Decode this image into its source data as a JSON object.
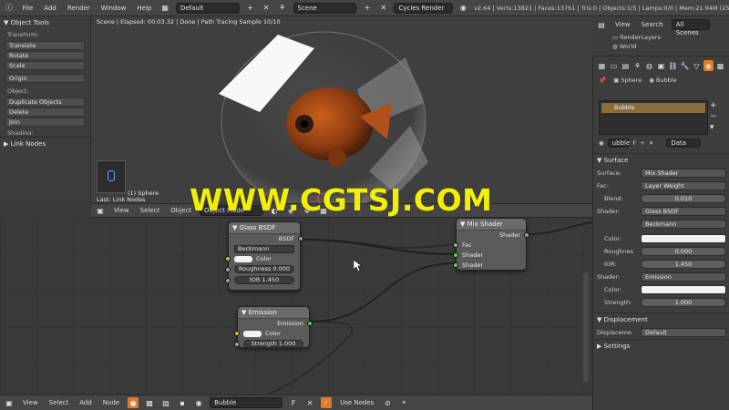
{
  "topbar": {
    "menu": [
      "File",
      "Add",
      "Render",
      "Window",
      "Help"
    ],
    "layout": "Default",
    "scene": "Scene",
    "engine": "Cycles Render",
    "stats": "v2.64 | Verts:13821 | Faces:13761 | Tris:0 | Objects:1/5 | Lamps:0/0 | Mem:21.94M (25.18M) | Sphere"
  },
  "toolshelf": {
    "title": "Object Tools",
    "transform_label": "Transform:",
    "transform_buttons": [
      "Translate",
      "Rotate",
      "Scale"
    ],
    "origin": "Origin",
    "object_label": "Object:",
    "object_buttons": [
      "Duplicate Objects",
      "Delete",
      "Join"
    ],
    "shading_label": "Shading:",
    "link_nodes": "Link Nodes"
  },
  "viewport": {
    "status": "Scene | Elapsed: 00:03.32 | Done | Path Tracing Sample 10/10",
    "object_label": "(1) Sphere",
    "last_op": "Last: Link Nodes"
  },
  "vp_header": {
    "menu": [
      "View",
      "Select",
      "Object"
    ],
    "mode": "Object Mode"
  },
  "nodes": {
    "glass": {
      "title": "Glass BSDF",
      "output": "BSDF",
      "distribution": "Beckmann",
      "color": "Color",
      "roughness": "Roughness 0.000",
      "ior": "IOR 1.450"
    },
    "emission": {
      "title": "Emission",
      "output": "Emission",
      "color": "Color",
      "strength": "Strength 1.000"
    },
    "mix": {
      "title": "Mix Shader",
      "output": "Shader",
      "inputs": [
        "Fac",
        "Shader",
        "Shader"
      ]
    }
  },
  "ne_header": {
    "menu": [
      "View",
      "Select",
      "Add",
      "Node"
    ],
    "material": "Bubble",
    "use_nodes": "Use Nodes"
  },
  "outliner": {
    "menu": [
      "View",
      "Search",
      "All Scenes"
    ],
    "items": [
      "RenderLayers",
      "World"
    ]
  },
  "props": {
    "breadcrumb": [
      "Sphere",
      "Bubble"
    ],
    "slot": "Bubble",
    "mat_field": "ubble",
    "data_select": "Data",
    "surface_section": "Surface",
    "surface": {
      "label": "Surface:",
      "value": "Mix Shader"
    },
    "fac": {
      "label": "Fac:",
      "value": "Layer Weight"
    },
    "blend": {
      "label": "Blend:",
      "value": "0.010"
    },
    "shader1": {
      "label": "Shader:",
      "value": "Glass BSDF"
    },
    "distribution": "Beckmann",
    "color_label": "Color:",
    "roughness": {
      "label": "Roughnes",
      "value": "0.000"
    },
    "ior": {
      "label": "IOR:",
      "value": "1.450"
    },
    "shader2": {
      "label": "Shader:",
      "value": "Emission"
    },
    "color2_label": "Color:",
    "strength": {
      "label": "Strength:",
      "value": "1.000"
    },
    "displacement_section": "Displacement",
    "displacement": {
      "label": "Displaceme",
      "value": "Default"
    },
    "settings_section": "Settings"
  },
  "watermark": "WWW.CGTSJ.COM",
  "colors": {
    "slot_highlight": "#8a6d3b",
    "watermark": "#f2ef00",
    "socket_shader": "#63c763"
  }
}
